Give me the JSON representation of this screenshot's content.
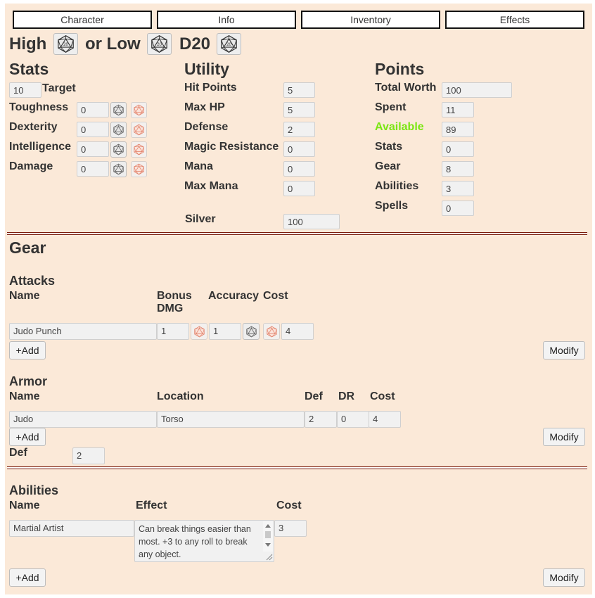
{
  "tabs": [
    "Character",
    "Info",
    "Inventory",
    "Effects"
  ],
  "roll": {
    "high": "High",
    "or_low": "or Low",
    "d20": "D20",
    "die_text": "20"
  },
  "stats": {
    "title": "Stats",
    "target_value": "10",
    "target_label": "Target",
    "items": [
      {
        "label": "Toughness",
        "value": "0"
      },
      {
        "label": "Dexterity",
        "value": "0"
      },
      {
        "label": "Intelligence",
        "value": "0"
      },
      {
        "label": "Damage",
        "value": "0"
      }
    ]
  },
  "utility": {
    "title": "Utility",
    "items": [
      {
        "label": "Hit Points",
        "value": "5"
      },
      {
        "label": "Max HP",
        "value": "5"
      },
      {
        "label": "Defense",
        "value": "2"
      },
      {
        "label": "Magic Resistance",
        "value": "0"
      },
      {
        "label": "Mana",
        "value": "0"
      },
      {
        "label": "Max Mana",
        "value": "0"
      }
    ],
    "silver_label": "Silver",
    "silver_value": "100"
  },
  "points": {
    "title": "Points",
    "total_label": "Total Worth",
    "total_value": "100",
    "items": [
      {
        "label": "Spent",
        "value": "11"
      },
      {
        "label": "Available",
        "value": "89"
      },
      {
        "label": "Stats",
        "value": "0"
      },
      {
        "label": "Gear",
        "value": "8"
      },
      {
        "label": "Abilities",
        "value": "3"
      },
      {
        "label": "Spells",
        "value": "0"
      }
    ]
  },
  "gear": {
    "title": "Gear",
    "attacks": {
      "title": "Attacks",
      "headers": {
        "name": "Name",
        "bonus_dmg": "Bonus DMG",
        "accuracy": "Accuracy",
        "cost": "Cost"
      },
      "row": {
        "name": "Judo Punch",
        "bonus_dmg": "1",
        "accuracy": "1",
        "cost": "4"
      },
      "add_label": "+Add",
      "modify_label": "Modify"
    },
    "armor": {
      "title": "Armor",
      "headers": {
        "name": "Name",
        "location": "Location",
        "def": "Def",
        "dr": "DR",
        "cost": "Cost"
      },
      "row": {
        "name": "Judo",
        "location": "Torso",
        "def": "2",
        "dr": "0",
        "cost": "4"
      },
      "add_label": "+Add",
      "modify_label": "Modify",
      "def_label": "Def",
      "def_value": "2"
    }
  },
  "abilities": {
    "title": "Abilities",
    "headers": {
      "name": "Name",
      "effect": "Effect",
      "cost": "Cost"
    },
    "row": {
      "name": "Martial Artist",
      "effect": "Can break things easier than most. +3 to any roll to break any object.",
      "cost": "3"
    },
    "add_label": "+Add",
    "modify_label": "Modify"
  },
  "colors": {
    "background": "#fbe9d8",
    "available": "#7be612",
    "divider": "#7a1a0a"
  },
  "icons": [
    "d20-die-icon",
    "d20-die-faded-icon"
  ]
}
